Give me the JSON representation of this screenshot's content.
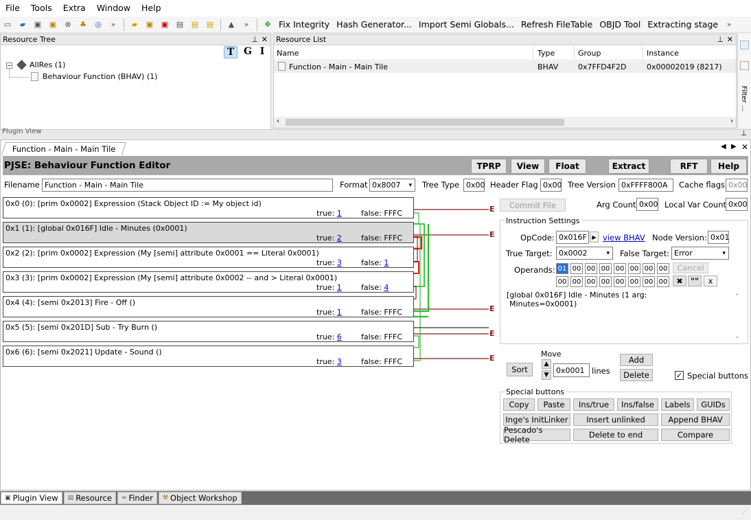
{
  "menu": [
    "File",
    "Tools",
    "Extra",
    "Window",
    "Help"
  ],
  "toolbar_actions": [
    "Fix Integrity",
    "Hash Generator...",
    "Import Semi Globals...",
    "Refresh FileTable",
    "OBJD Tool",
    "Extracting stage"
  ],
  "resource_tree": {
    "title": "Resource Tree",
    "buttons": [
      "T",
      "G",
      "I"
    ],
    "root": "AllRes (1)",
    "child": "Behaviour Function (BHAV) (1)"
  },
  "resource_list": {
    "title": "Resource List",
    "headers": [
      "Name",
      "Type",
      "Group",
      "Instance"
    ],
    "row": {
      "name": "Function - Main - Main Tile",
      "type": "BHAV",
      "group": "0x7FFD4F2D",
      "instance": "0x00002019 (8217)"
    }
  },
  "side_tabs": [
    "Filter ..."
  ],
  "plugin_view_label": "Plugin View",
  "doc_tab": "Function - Main - Main Tile",
  "editor": {
    "title": "PJSE: Behaviour Function Editor",
    "buttons": [
      "TPRP",
      "View",
      "Float",
      "Extract",
      "RFT",
      "Help"
    ],
    "filename_label": "Filename",
    "filename": "Function - Main - Main Tile",
    "format_label": "Format",
    "format": "0x8007",
    "tree_type_label": "Tree Type",
    "tree_type": "0x00",
    "header_flag_label": "Header Flag",
    "header_flag": "0x00",
    "tree_version_label": "Tree Version",
    "tree_version": "0xFFFF800A",
    "cache_flags_label": "Cache flags",
    "cache_flags": "0x00",
    "commit_label": "Commit File",
    "arg_count_label": "Arg Count",
    "arg_count": "0x00",
    "local_var_label": "Local Var Count",
    "local_var": "0x00"
  },
  "nodes": [
    {
      "text": "0x0 (0): [prim 0x0002] Expression (Stack Object ID := My object id)",
      "true_label": "true:",
      "true": "1",
      "false_label": "false:",
      "false": "FFFC",
      "false_link": false
    },
    {
      "text": "0x1 (1): [global 0x016F] Idle - Minutes (0x0001)",
      "true_label": "true:",
      "true": "2",
      "false_label": "false:",
      "false": "FFFC",
      "false_link": false
    },
    {
      "text": "0x2 (2): [prim 0x0002] Expression (My [semi] attribute 0x0001 == Literal 0x0001)",
      "true_label": "true:",
      "true": "3",
      "false_label": "false:",
      "false": "1",
      "false_link": true
    },
    {
      "text": "0x3 (3): [prim 0x0002] Expression (My [semi] attribute 0x0002 -- and > Literal 0x0001)",
      "true_label": "true:",
      "true": "1",
      "false_label": "false:",
      "false": "4",
      "false_link": true
    },
    {
      "text": "0x4 (4): [semi 0x2013] Fire - Off ()",
      "true_label": "true:",
      "true": "1",
      "false_label": "false:",
      "false": "FFFC",
      "false_link": false
    },
    {
      "text": "0x5 (5): [semi 0x201D] Sub - Try Burn ()",
      "true_label": "true:",
      "true": "6",
      "false_label": "false:",
      "false": "FFFC",
      "false_link": false
    },
    {
      "text": "0x6 (6): [semi 0x2021] Update - Sound ()",
      "true_label": "true:",
      "true": "3",
      "false_label": "false:",
      "false": "FFFC",
      "false_link": false
    }
  ],
  "error_marker": "E",
  "instruction": {
    "group_label": "Instruction Settings",
    "opcode_label": "OpCode:",
    "opcode": "0x016F",
    "view_bhav": "view BHAV",
    "node_version_label": "Node Version:",
    "node_version": "0x01",
    "true_target_label": "True Target:",
    "true_target": "0x0002",
    "false_target_label": "False Target:",
    "false_target": "Error",
    "operands_label": "Operands:",
    "operands_row1": [
      "01",
      "00",
      "00",
      "00",
      "00",
      "00",
      "00",
      "00"
    ],
    "operands_row2": [
      "00",
      "00",
      "00",
      "00",
      "00",
      "00",
      "00",
      "00"
    ],
    "cancel": "Cancel",
    "quote_btn": "\"\"",
    "x_btn": "x",
    "description_line1": "[global 0x016F] Idle - Minutes (1 arg:",
    "description_line2": "Minutes=0x0001)"
  },
  "move": {
    "label": "Move",
    "sort": "Sort",
    "value": "0x0001",
    "unit": "lines",
    "add": "Add",
    "delete": "Delete",
    "special_check": "Special buttons"
  },
  "special": {
    "label": "Special buttons",
    "row1": [
      "Copy",
      "Paste",
      "Ins/true",
      "Ins/false",
      "Labels",
      "GUIDs"
    ],
    "row2": [
      "Inge's InitLinker",
      "Insert unlinked",
      "Append BHAV"
    ],
    "row3": [
      "Pescado's Delete",
      "Delete to end",
      "Compare"
    ]
  },
  "bottom_tabs": [
    "Plugin View",
    "Resource",
    "Finder",
    "Object Workshop"
  ]
}
